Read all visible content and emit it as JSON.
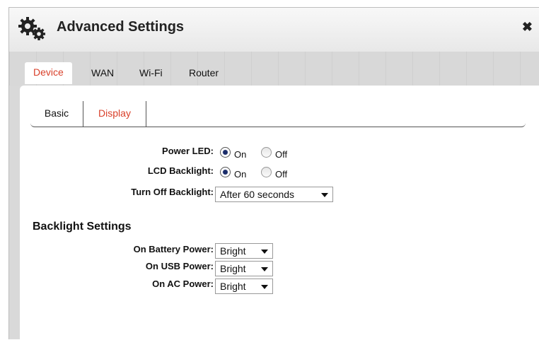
{
  "dialog": {
    "title": "Advanced Settings",
    "close_glyph": "✖",
    "title_icon": "gears-icon"
  },
  "tabs": [
    {
      "label": "Device",
      "active": true
    },
    {
      "label": "WAN",
      "active": false
    },
    {
      "label": "Wi-Fi",
      "active": false
    },
    {
      "label": "Router",
      "active": false
    }
  ],
  "subtabs": [
    {
      "label": "Basic",
      "active": false
    },
    {
      "label": "Display",
      "active": true
    }
  ],
  "display": {
    "power_led": {
      "label": "Power LED:",
      "on_label": "On",
      "off_label": "Off",
      "selected": "On"
    },
    "lcd_backlight": {
      "label": "LCD Backlight:",
      "on_label": "On",
      "off_label": "Off",
      "selected": "On"
    },
    "turn_off_backlight": {
      "label": "Turn Off Backlight:",
      "value": "After 60 seconds"
    }
  },
  "backlight_settings": {
    "title": "Backlight Settings",
    "battery": {
      "label": "On Battery Power:",
      "value": "Bright"
    },
    "usb": {
      "label": "On USB Power:",
      "value": "Bright"
    },
    "ac": {
      "label": "On AC Power:",
      "value": "Bright"
    }
  },
  "colors": {
    "active_tab_text": "#d9402a",
    "radio_selected": "#1a2c6a"
  }
}
